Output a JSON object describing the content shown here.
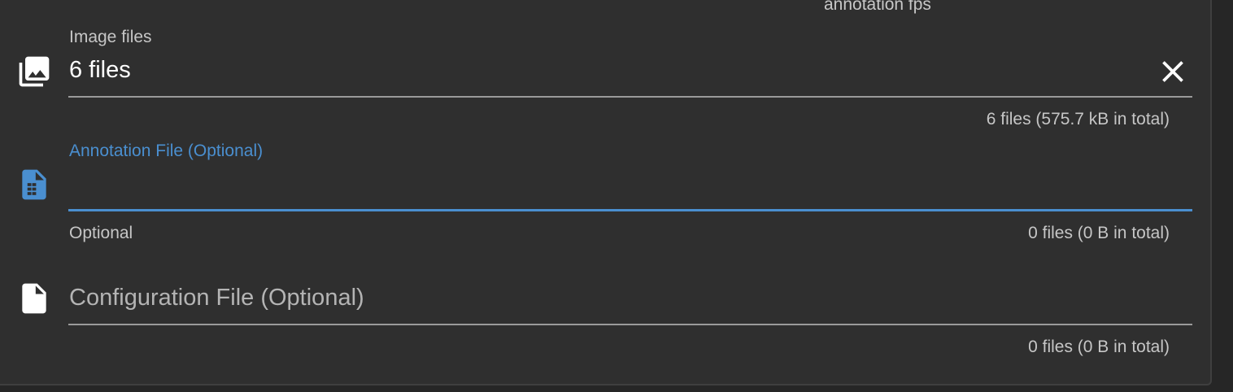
{
  "top_hint": "annotation fps",
  "image_field": {
    "icon": "photo-library-icon",
    "label": "Image files",
    "value": "6 files",
    "clear_icon": "close-icon",
    "summary": "6 files (575.7 kB in total)"
  },
  "annotation_field": {
    "icon": "spreadsheet-file-icon",
    "label": "Annotation File (Optional)",
    "helper": "Optional",
    "summary": "0 files (0 B in total)",
    "accent_color": "#4a8fd0"
  },
  "config_field": {
    "icon": "file-icon",
    "placeholder": "Configuration File (Optional)",
    "summary": "0 files (0 B in total)"
  }
}
